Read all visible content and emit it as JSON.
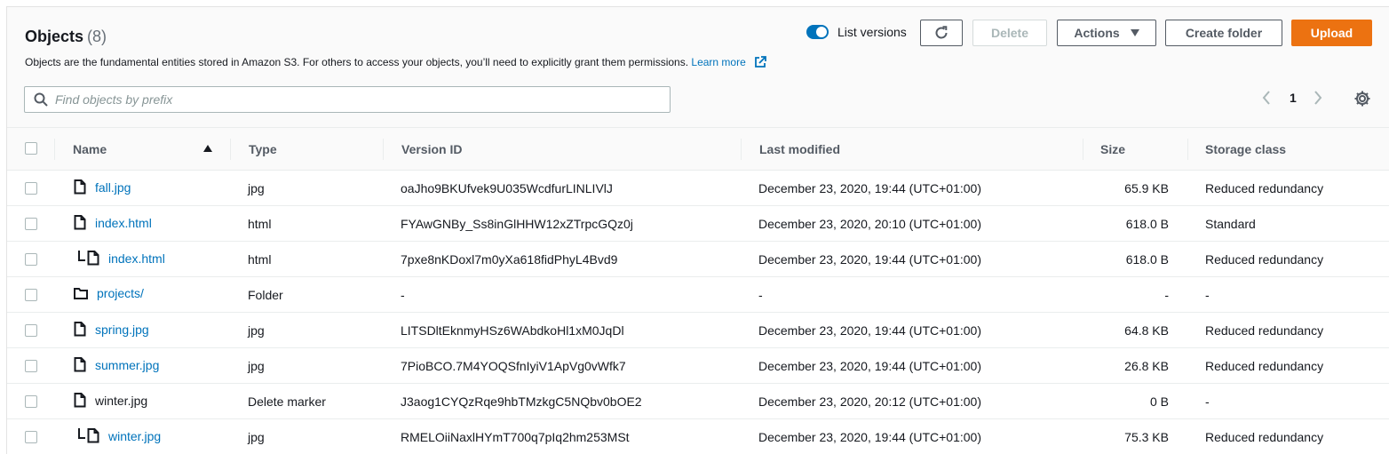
{
  "header": {
    "title": "Objects",
    "count": "(8)",
    "description": "Objects are the fundamental entities stored in Amazon S3. For others to access your objects, you’ll need to explicitly grant them permissions.",
    "learn_more": "Learn more"
  },
  "toolbar": {
    "list_versions_label": "List versions",
    "list_versions_on": true,
    "delete_label": "Delete",
    "actions_label": "Actions",
    "create_folder_label": "Create folder",
    "upload_label": "Upload"
  },
  "search": {
    "placeholder": "Find objects by prefix"
  },
  "pagination": {
    "page": "1"
  },
  "columns": {
    "name": "Name",
    "type": "Type",
    "version_id": "Version ID",
    "last_modified": "Last modified",
    "size": "Size",
    "storage_class": "Storage class"
  },
  "rows": [
    {
      "name": "fall.jpg",
      "type": "jpg",
      "version_id": "oaJho9BKUfvek9U035WcdfurLINLIVlJ",
      "last_modified": "December 23, 2020, 19:44 (UTC+01:00)",
      "size": "65.9 KB",
      "storage_class": "Reduced redundancy",
      "icon": "file-icon",
      "child": false,
      "link": true
    },
    {
      "name": "index.html",
      "type": "html",
      "version_id": "FYAwGNBy_Ss8inGlHHW12xZTrpcGQz0j",
      "last_modified": "December 23, 2020, 20:10 (UTC+01:00)",
      "size": "618.0 B",
      "storage_class": "Standard",
      "icon": "file-icon",
      "child": false,
      "link": true
    },
    {
      "name": "index.html",
      "type": "html",
      "version_id": "7pxe8nKDoxl7m0yXa618fidPhyL4Bvd9",
      "last_modified": "December 23, 2020, 19:44 (UTC+01:00)",
      "size": "618.0 B",
      "storage_class": "Reduced redundancy",
      "icon": "file-icon",
      "child": true,
      "link": true
    },
    {
      "name": "projects/",
      "type": "Folder",
      "version_id": "-",
      "last_modified": "-",
      "size": "-",
      "storage_class": "-",
      "icon": "folder-icon",
      "child": false,
      "link": true
    },
    {
      "name": "spring.jpg",
      "type": "jpg",
      "version_id": "LITSDltEknmyHSz6WAbdkoHl1xM0JqDl",
      "last_modified": "December 23, 2020, 19:44 (UTC+01:00)",
      "size": "64.8 KB",
      "storage_class": "Reduced redundancy",
      "icon": "file-icon",
      "child": false,
      "link": true
    },
    {
      "name": "summer.jpg",
      "type": "jpg",
      "version_id": "7PioBCO.7M4YOQSfnIyiV1ApVg0vWfk7",
      "last_modified": "December 23, 2020, 19:44 (UTC+01:00)",
      "size": "26.8 KB",
      "storage_class": "Reduced redundancy",
      "icon": "file-icon",
      "child": false,
      "link": true
    },
    {
      "name": "winter.jpg",
      "type": "Delete marker",
      "version_id": "J3aog1CYQzRqe9hbTMzkgC5NQbv0bOE2",
      "last_modified": "December 23, 2020, 20:12 (UTC+01:00)",
      "size": "0 B",
      "storage_class": "-",
      "icon": "file-icon",
      "child": false,
      "link": false
    },
    {
      "name": "winter.jpg",
      "type": "jpg",
      "version_id": "RMELOiiNaxlHYmT700q7pIq2hm253MSt",
      "last_modified": "December 23, 2020, 19:44 (UTC+01:00)",
      "size": "75.3 KB",
      "storage_class": "Reduced redundancy",
      "icon": "file-icon",
      "child": true,
      "link": true
    }
  ],
  "colors": {
    "link": "#0073bb",
    "primary": "#ec7211",
    "toggle": "#0073bb"
  }
}
